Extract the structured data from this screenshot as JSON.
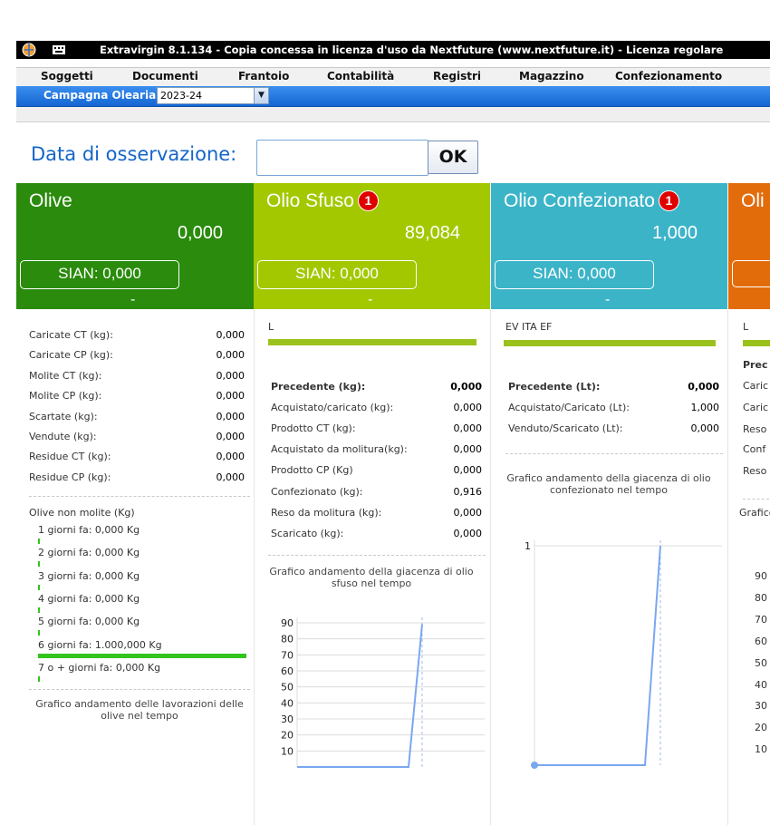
{
  "titlebar": {
    "title": "Extravirgin 8.1.134 - Copia concessa in licenza d'uso da Nextfuture (www.nextfuture.it) - Licenza regolare",
    "app_icon": "globe-icon",
    "keyboard_icon": "keyboard-icon"
  },
  "menu": [
    "Soggetti",
    "Documenti",
    "Frantoio",
    "Contabilità",
    "Registri",
    "Magazzino",
    "Confezionamento"
  ],
  "campagna": {
    "label": "Campagna Olearia:",
    "value": "2023-24"
  },
  "observation": {
    "label": "Data di osservazione:",
    "value": "",
    "ok": "OK"
  },
  "colors": {
    "olive": "#2a8b0c",
    "sfuso": "#a3c800",
    "confezionato": "#3cb4c8",
    "orange": "#e36c0a",
    "link_blue": "#1566c8",
    "bar_green": "#9bc21c"
  },
  "tiles": {
    "olive": {
      "title": "Olive",
      "value": "0,000",
      "sian": "SIAN: 0,000",
      "dash": "-"
    },
    "sfuso": {
      "title": "Olio Sfuso",
      "badge": "1",
      "value": "89,084",
      "sian": "SIAN: 0,000",
      "dash": "-"
    },
    "confezionato": {
      "title": "Olio Confezionato",
      "badge": "1",
      "value": "1,000",
      "sian": "SIAN: 0,000",
      "dash": "-"
    },
    "fourth": {
      "title": "Oli",
      "sian": "S"
    }
  },
  "olive_panel": {
    "rows": [
      {
        "label": "Caricate CT (kg):",
        "value": "0,000"
      },
      {
        "label": "Caricate CP (kg):",
        "value": "0,000"
      },
      {
        "label": "Molite CT (kg):",
        "value": "0,000"
      },
      {
        "label": "Molite CP (kg):",
        "value": "0,000"
      },
      {
        "label": "Scartate (kg):",
        "value": "0,000"
      },
      {
        "label": "Vendute (kg):",
        "value": "0,000"
      },
      {
        "label": "Residue CT (kg):",
        "value": "0,000"
      },
      {
        "label": "Residue CP (kg):",
        "value": "0,000"
      }
    ],
    "non_molite_title": "Olive non molite (Kg)",
    "non_molite": [
      {
        "label": "1 giorni fa: 0,000 Kg",
        "fraction": 0
      },
      {
        "label": "2 giorni fa: 0,000 Kg",
        "fraction": 0
      },
      {
        "label": "3 giorni fa: 0,000 Kg",
        "fraction": 0
      },
      {
        "label": "4 giorni fa: 0,000 Kg",
        "fraction": 0
      },
      {
        "label": "5 giorni fa: 0,000 Kg",
        "fraction": 0
      },
      {
        "label": "6 giorni fa: 1.000,000 Kg",
        "fraction": 1
      },
      {
        "label": "7 o + giorni fa: 0,000 Kg",
        "fraction": 0
      }
    ],
    "chart_title": "Grafico andamento delle lavorazioni delle olive nel tempo"
  },
  "sfuso_panel": {
    "code": "L",
    "rows": [
      {
        "label": "Precedente (kg):",
        "value": "0,000",
        "bold": true
      },
      {
        "label": "Acquistato/caricato (kg):",
        "value": "0,000"
      },
      {
        "label": "Prodotto CT (kg):",
        "value": "0,000"
      },
      {
        "label": "Acquistato da molitura(kg):",
        "value": "0,000"
      },
      {
        "label": "Prodotto CP (Kg)",
        "value": "0,000"
      },
      {
        "label": "Confezionato (kg):",
        "value": "0,916"
      },
      {
        "label": "Reso da molitura (kg):",
        "value": "0,000"
      },
      {
        "label": "Scaricato (kg):",
        "value": "0,000"
      }
    ],
    "chart_title": "Grafico andamento della giacenza di olio sfuso nel tempo"
  },
  "conf_panel": {
    "code": "EV ITA EF",
    "rows": [
      {
        "label": "Precedente (Lt):",
        "value": "0,000",
        "bold": true
      },
      {
        "label": "Acquistato/Caricato (Lt):",
        "value": "1,000"
      },
      {
        "label": "Venduto/Scaricato (Lt):",
        "value": "0,000"
      }
    ],
    "chart_title": "Grafico andamento della giacenza di olio confezionato nel tempo"
  },
  "fourth_panel": {
    "code": "L",
    "rows": [
      "Prec",
      "Caric",
      "Caric",
      "Reso",
      "Conf",
      "Reso"
    ],
    "chart_title": "Grafico",
    "ticks": [
      "90",
      "80",
      "70",
      "60",
      "50",
      "40",
      "30",
      "20",
      "10"
    ]
  },
  "chart_data": [
    {
      "type": "line",
      "title": "Grafico andamento della giacenza di olio sfuso nel tempo",
      "yticks": [
        10,
        20,
        30,
        40,
        50,
        60,
        70,
        80,
        90
      ],
      "ylim": [
        0,
        90
      ],
      "y": [
        0,
        0,
        0,
        0,
        0,
        0,
        89.084
      ],
      "grid": true
    },
    {
      "type": "line",
      "title": "Grafico andamento della giacenza di olio confezionato nel tempo",
      "yticks": [
        1
      ],
      "ylim": [
        0,
        1
      ],
      "y": [
        0,
        0,
        0,
        0,
        0,
        0,
        1
      ],
      "grid": true
    }
  ]
}
